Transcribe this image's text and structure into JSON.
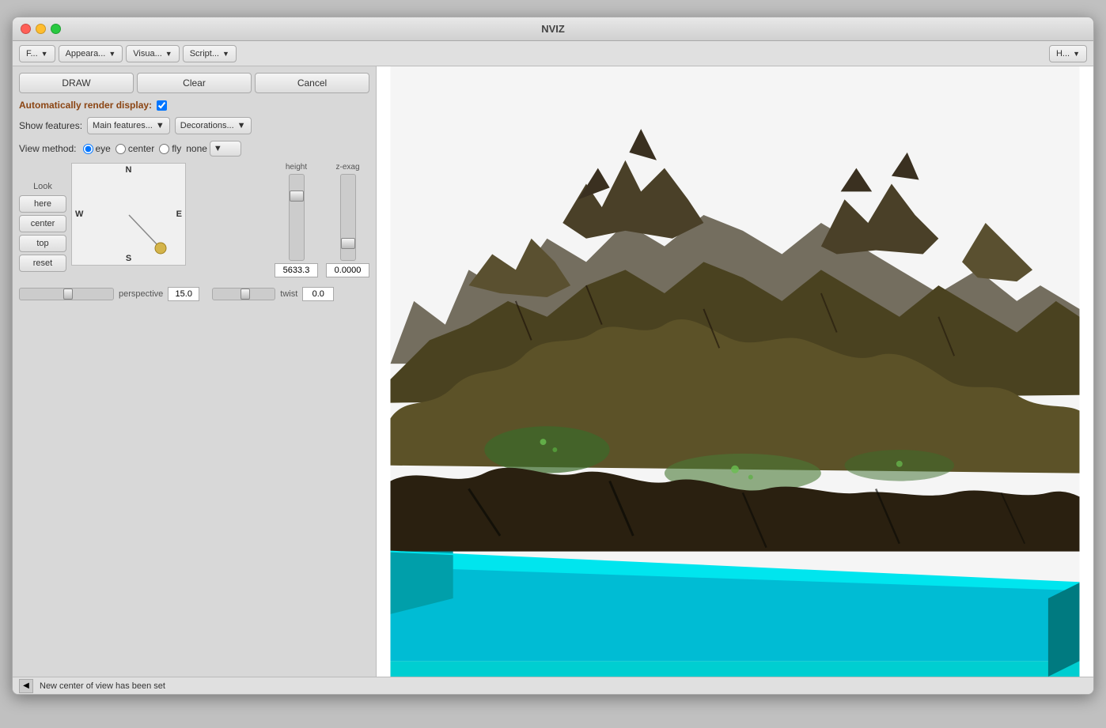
{
  "window": {
    "title": "NVIZ"
  },
  "menubar": {
    "items": [
      {
        "id": "file",
        "label": "F...",
        "arrow": "▼"
      },
      {
        "id": "appearance",
        "label": "Appeara...",
        "arrow": "▼"
      },
      {
        "id": "visual",
        "label": "Visua...",
        "arrow": "▼"
      },
      {
        "id": "script",
        "label": "Script...",
        "arrow": "▼"
      }
    ],
    "right_item": {
      "label": "H...",
      "arrow": "▼"
    }
  },
  "toolbar": {
    "draw_label": "DRAW",
    "clear_label": "Clear",
    "cancel_label": "Cancel"
  },
  "auto_render": {
    "label": "Automatically render display:",
    "checked": true
  },
  "show_features": {
    "label": "Show features:",
    "options": [
      "Main features...",
      "Decorations..."
    ],
    "selected_main": "Main features...",
    "selected_deco": "Decorations..."
  },
  "view_method": {
    "label": "View method:",
    "options": [
      "eye",
      "center",
      "fly",
      "none"
    ],
    "selected": "eye"
  },
  "look": {
    "label": "Look",
    "buttons": [
      "here",
      "center",
      "top",
      "reset"
    ]
  },
  "compass": {
    "directions": {
      "N": "N",
      "S": "S",
      "W": "W",
      "E": "E"
    }
  },
  "height": {
    "label": "height",
    "value": "5633.3"
  },
  "zexag": {
    "label": "z-exag",
    "value": "0.0000"
  },
  "perspective": {
    "label": "perspective",
    "value": "15.0"
  },
  "twist": {
    "label": "twist",
    "value": "0.0"
  },
  "statusbar": {
    "message": "New center of view has been set"
  },
  "colors": {
    "accent_orange": "#8b4513",
    "bg_sidebar": "#d8d8d8",
    "bg_viewport": "#ffffff"
  }
}
